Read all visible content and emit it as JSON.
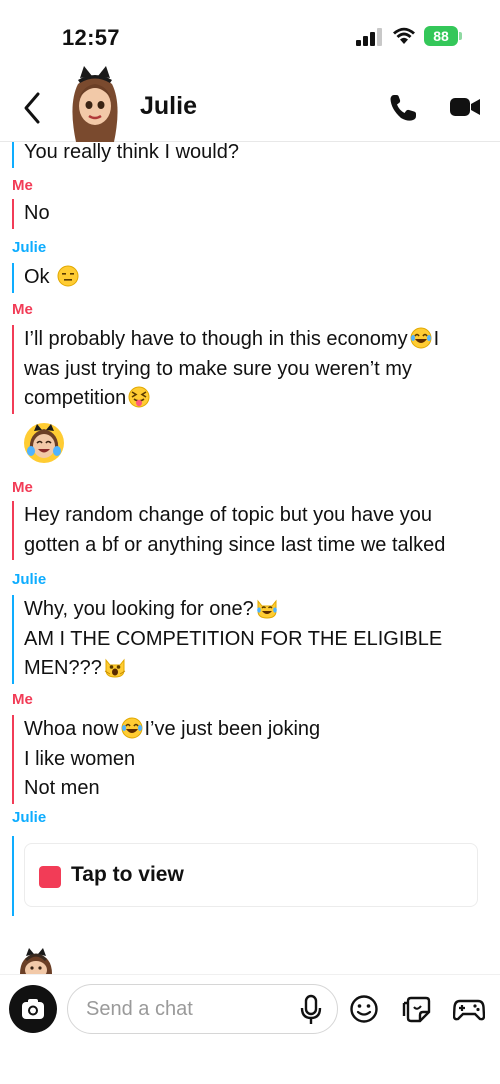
{
  "status_bar": {
    "time": "12:57",
    "battery": "88",
    "icons": [
      "signal-icon",
      "wifi-icon",
      "battery-icon"
    ]
  },
  "header": {
    "contact_name": "Julie",
    "icons": [
      "back-chevron-icon",
      "bitmoji-avatar",
      "phone-icon",
      "video-camera-icon"
    ]
  },
  "colors": {
    "me": "#f23c57",
    "julie": "#0eadff",
    "battery": "#34c759"
  },
  "chat": {
    "m0": {
      "text": "You really think I would?"
    },
    "s1": "Me",
    "m1": {
      "text": "No"
    },
    "s2": "Julie",
    "m2": {
      "text": "Ok",
      "emoji": "expressionless-face-emoji"
    },
    "s3": "Me",
    "m3": {
      "l1": "I’ll probably have to though in this economy",
      "l1_tail": "I",
      "l2": "was just trying to make sure you weren’t my",
      "l3": "competition",
      "emojis": [
        "tears-of-joy-emoji",
        "squinting-tongue-emoji"
      ]
    },
    "bitmoji_reaction": "bitmoji-laughing-sticker",
    "s4": "Me",
    "m4": {
      "l1": "Hey random change of topic but you have you",
      "l2": "gotten a bf or anything since last time we talked"
    },
    "s5": "Julie",
    "m5": {
      "l1": "Why, you looking for one?",
      "l2": "AM I THE COMPETITION FOR THE ELIGIBLE",
      "l3": "MEN???",
      "emojis": [
        "cat-tears-of-joy-emoji",
        "weary-cat-emoji"
      ]
    },
    "s6": "Me",
    "m6": {
      "l1a": "Whoa now",
      "l1b": "I’ve just been joking",
      "l2": "I like women",
      "l3": "Not men",
      "emojis": [
        "tears-of-joy-emoji"
      ]
    },
    "s7": "Julie",
    "snap": {
      "label": "Tap to view",
      "icon": "unopened-snap-icon"
    },
    "typing_indicator": "bitmoji-peeking-icon"
  },
  "bottom_bar": {
    "input_placeholder": "Send a chat",
    "icons": [
      "camera-icon",
      "microphone-icon",
      "smiley-icon",
      "sticker-icon",
      "game-controller-icon"
    ]
  }
}
